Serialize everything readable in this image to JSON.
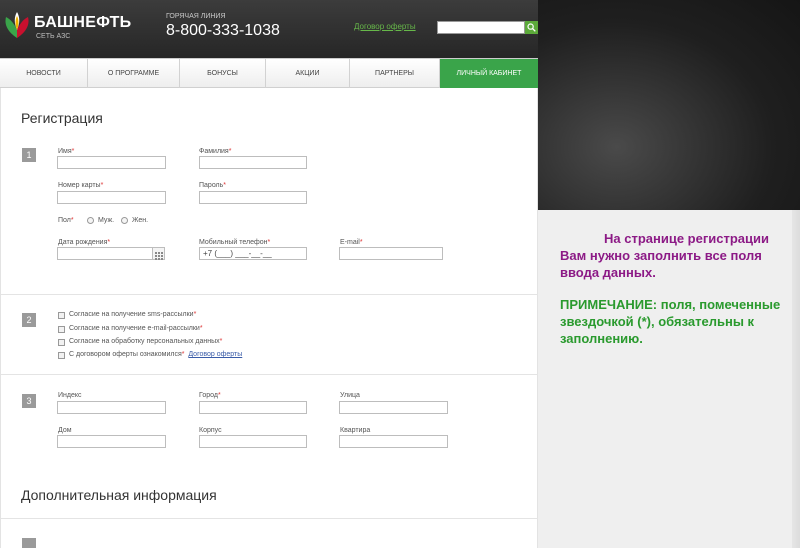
{
  "header": {
    "brand_name": "БАШНЕФТЬ",
    "brand_sub": "СЕТЬ АЗС",
    "hotline_label": "ГОРЯЧАЯ ЛИНИЯ",
    "hotline_phone": "8-800-333-1038",
    "offer_link": "Договор оферты",
    "search_placeholder": "",
    "brand_colors": {
      "green": "#3aa44a",
      "red": "#c8102e",
      "yellow": "#f0b400"
    }
  },
  "nav": {
    "items": [
      {
        "label": "НОВОСТИ"
      },
      {
        "label": "О ПРОГРАММЕ"
      },
      {
        "label": "БОНУСЫ"
      },
      {
        "label": "АКЦИИ"
      },
      {
        "label": "ПАРТНЕРЫ"
      },
      {
        "label": "ЛИЧНЫЙ КАБИНЕТ",
        "active": true
      }
    ]
  },
  "registration": {
    "title": "Регистрация",
    "step1": {
      "number": "1",
      "first_name_label": "Имя",
      "last_name_label": "Фамилия",
      "card_number_label": "Номер карты",
      "password_label": "Пароль",
      "gender_label": "Пол",
      "gender_male": "Муж.",
      "gender_female": "Жен.",
      "birth_date_label": "Дата рождения",
      "mobile_label": "Мобильный телефон",
      "mobile_value": "+7 (___) ___-__-__",
      "email_label": "E-mail",
      "required_mark": "*"
    },
    "step2": {
      "number": "2",
      "sms_consent": "Согласие на получение sms-рассылки",
      "email_consent": "Согласие на получение e-mail-рассылки",
      "data_consent": "Согласие на обработку персональных данных",
      "offer_agreement": "С договором оферты ознакомился",
      "offer_link": "Договор оферты"
    },
    "step3": {
      "number": "3",
      "index_label": "Индекс",
      "city_label": "Город",
      "street_label": "Улица",
      "house_label": "Дом",
      "building_label": "Корпус",
      "apartment_label": "Квартира"
    }
  },
  "additional": {
    "title": "Дополнительная информация"
  },
  "note": {
    "line1": "На странице регистрации",
    "line2": "Вам нужно заполнить все поля ввода данных.",
    "remark": "ПРИМЕЧАНИЕ: поля, помеченные звездочкой (*), обязательны к заполнению."
  }
}
